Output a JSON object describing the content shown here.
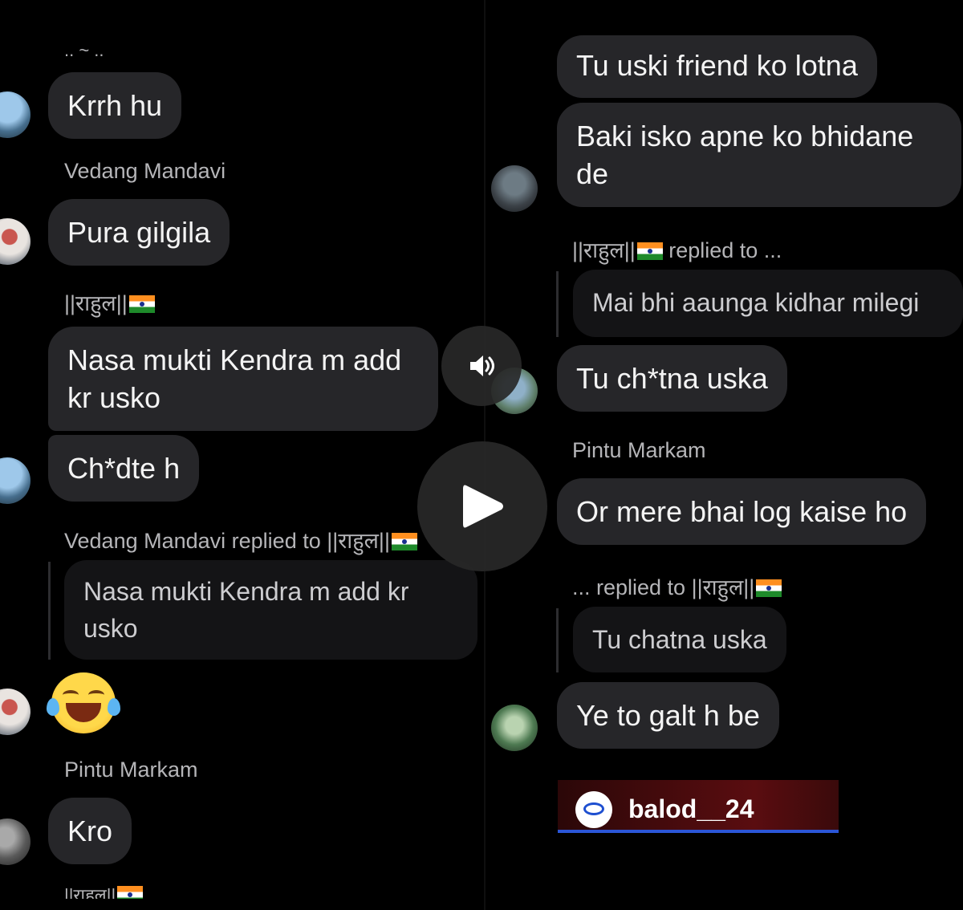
{
  "left": {
    "top_partial": "..  ~  ..",
    "msg1": "Krrh hu",
    "name1": "Vedang Mandavi",
    "msg2": "Pura gilgila",
    "name2": "||राहुल||",
    "msg3": "Nasa mukti Kendra m add\nkr usko",
    "msg4": "Ch*dte h",
    "reply_header": "Vedang Mandavi replied to ||राहुल||",
    "quote": "Nasa mukti Kendra m add kr\nusko",
    "emoji": "laughing-crying-face",
    "name3": "Pintu Markam",
    "msg5": "Kro",
    "bottom_partial": "||राहुल||"
  },
  "right": {
    "msg1": "Tu uski friend ko lotna",
    "msg2": "Baki isko apne ko bhidane\nde",
    "reply1_header": "||राहुल||",
    "reply1_suffix": " replied to ...",
    "quote1": "Mai bhi aaunga kidhar milegi",
    "msg3": "Tu ch*tna uska",
    "name1": "Pintu Markam",
    "msg4": "Or mere bhai log kaise ho",
    "reply2_header": "... replied to ||राहुल||",
    "quote2": "Tu chatna uska",
    "msg5": "Ye to galt h be"
  },
  "watermark": {
    "text": "balod__24"
  },
  "controls": {
    "mute_icon": "speaker-icon",
    "play_icon": "play-icon"
  }
}
